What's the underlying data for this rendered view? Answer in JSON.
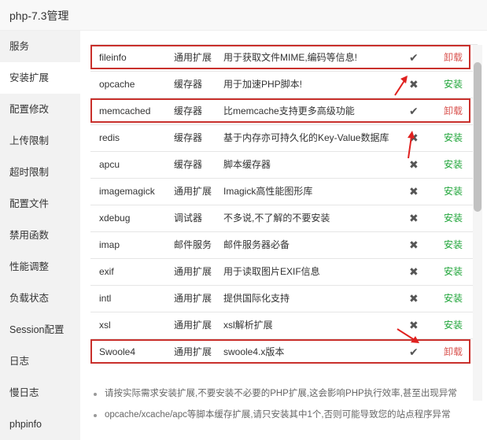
{
  "window": {
    "title": "php-7.3管理"
  },
  "sidebar": {
    "items": [
      {
        "label": "服务"
      },
      {
        "label": "安装扩展"
      },
      {
        "label": "配置修改"
      },
      {
        "label": "上传限制"
      },
      {
        "label": "超时限制"
      },
      {
        "label": "配置文件"
      },
      {
        "label": "禁用函数"
      },
      {
        "label": "性能调整"
      },
      {
        "label": "负载状态"
      },
      {
        "label": "Session配置"
      },
      {
        "label": "日志"
      },
      {
        "label": "慢日志"
      },
      {
        "label": "phpinfo"
      }
    ],
    "active_index": 1
  },
  "extensions": [
    {
      "name": "fileinfo",
      "type": "通用扩展",
      "desc": "用于获取文件MIME,编码等信息!",
      "installed": true,
      "status_icon": "check-icon",
      "action": "卸载",
      "highlighted": true
    },
    {
      "name": "opcache",
      "type": "缓存器",
      "desc": "用于加速PHP脚本!",
      "installed": false,
      "status_icon": "cross-icon",
      "action": "安装",
      "highlighted": false
    },
    {
      "name": "memcached",
      "type": "缓存器",
      "desc": "比memcache支持更多高级功能",
      "installed": true,
      "status_icon": "check-icon",
      "action": "卸载",
      "highlighted": true
    },
    {
      "name": "redis",
      "type": "缓存器",
      "desc": "基于内存亦可持久化的Key-Value数据库",
      "installed": false,
      "status_icon": "cross-icon",
      "action": "安装",
      "highlighted": false
    },
    {
      "name": "apcu",
      "type": "缓存器",
      "desc": "脚本缓存器",
      "installed": false,
      "status_icon": "cross-icon",
      "action": "安装",
      "highlighted": false
    },
    {
      "name": "imagemagick",
      "type": "通用扩展",
      "desc": "Imagick高性能图形库",
      "installed": false,
      "status_icon": "cross-icon",
      "action": "安装",
      "highlighted": false
    },
    {
      "name": "xdebug",
      "type": "调试器",
      "desc": "不多说,不了解的不要安装",
      "installed": false,
      "status_icon": "cross-icon",
      "action": "安装",
      "highlighted": false
    },
    {
      "name": "imap",
      "type": "邮件服务",
      "desc": "邮件服务器必备",
      "installed": false,
      "status_icon": "cross-icon",
      "action": "安装",
      "highlighted": false
    },
    {
      "name": "exif",
      "type": "通用扩展",
      "desc": "用于读取图片EXIF信息",
      "installed": false,
      "status_icon": "cross-icon",
      "action": "安装",
      "highlighted": false
    },
    {
      "name": "intl",
      "type": "通用扩展",
      "desc": "提供国际化支持",
      "installed": false,
      "status_icon": "cross-icon",
      "action": "安装",
      "highlighted": false
    },
    {
      "name": "xsl",
      "type": "通用扩展",
      "desc": "xsl解析扩展",
      "installed": false,
      "status_icon": "cross-icon",
      "action": "安装",
      "highlighted": false
    },
    {
      "name": "Swoole4",
      "type": "通用扩展",
      "desc": "swoole4.x版本",
      "installed": true,
      "status_icon": "check-icon",
      "action": "卸载",
      "highlighted": true
    }
  ],
  "notes": [
    "请按实际需求安装扩展,不要安装不必要的PHP扩展,这会影响PHP执行效率,甚至出现异常",
    "opcache/xcache/apc等脚本缓存扩展,请只安装其中1个,否则可能导致您的站点程序异常"
  ],
  "colors": {
    "install": "#20a53a",
    "uninstall": "#d9534f",
    "highlight_box": "#c9302c",
    "arrow": "#e0211f",
    "sidebar_bg": "#f2f2f2"
  }
}
